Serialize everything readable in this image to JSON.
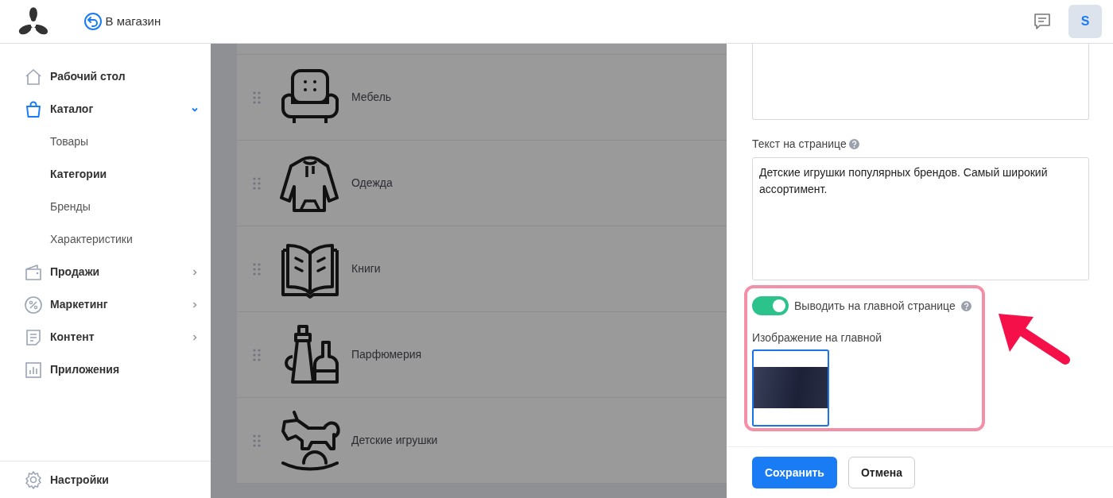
{
  "header": {
    "store_link": "В магазин",
    "avatar": "S"
  },
  "sidebar": {
    "items": [
      {
        "label": "Рабочий стол",
        "kind": "home",
        "selected": false
      },
      {
        "label": "Каталог",
        "kind": "bag",
        "selected": true,
        "expanded": true,
        "children": [
          {
            "label": "Товары",
            "selected": false
          },
          {
            "label": "Категории",
            "selected": true
          },
          {
            "label": "Бренды",
            "selected": false
          },
          {
            "label": "Характеристики",
            "selected": false
          }
        ]
      },
      {
        "label": "Продажи",
        "kind": "sales",
        "selected": false,
        "expanded": false
      },
      {
        "label": "Маркетинг",
        "kind": "percent",
        "selected": false,
        "expanded": false
      },
      {
        "label": "Контент",
        "kind": "doc",
        "selected": false,
        "expanded": false
      },
      {
        "label": "Приложения",
        "kind": "chart",
        "selected": false
      }
    ],
    "footer": {
      "label": "Настройки",
      "kind": "gear"
    }
  },
  "categories": [
    {
      "name": "Мебель",
      "kind": "armchair"
    },
    {
      "name": "Одежда",
      "kind": "hoodie"
    },
    {
      "name": "Книги",
      "kind": "book"
    },
    {
      "name": "Парфюмерия",
      "kind": "bottles"
    },
    {
      "name": "Детские игрушки",
      "kind": "horse"
    }
  ],
  "panel": {
    "page_text": {
      "label": "Текст на странице",
      "value": "Детские игрушки популярных брендов. Самый широкий ассортимент."
    },
    "home_toggle": {
      "label": "Выводить на главной странице",
      "on": true
    },
    "home_image": {
      "label": "Изображение на главной"
    },
    "buttons": [
      {
        "label": "Сохранить",
        "kind": "primary"
      },
      {
        "label": "Отмена",
        "kind": "secondary"
      }
    ]
  }
}
